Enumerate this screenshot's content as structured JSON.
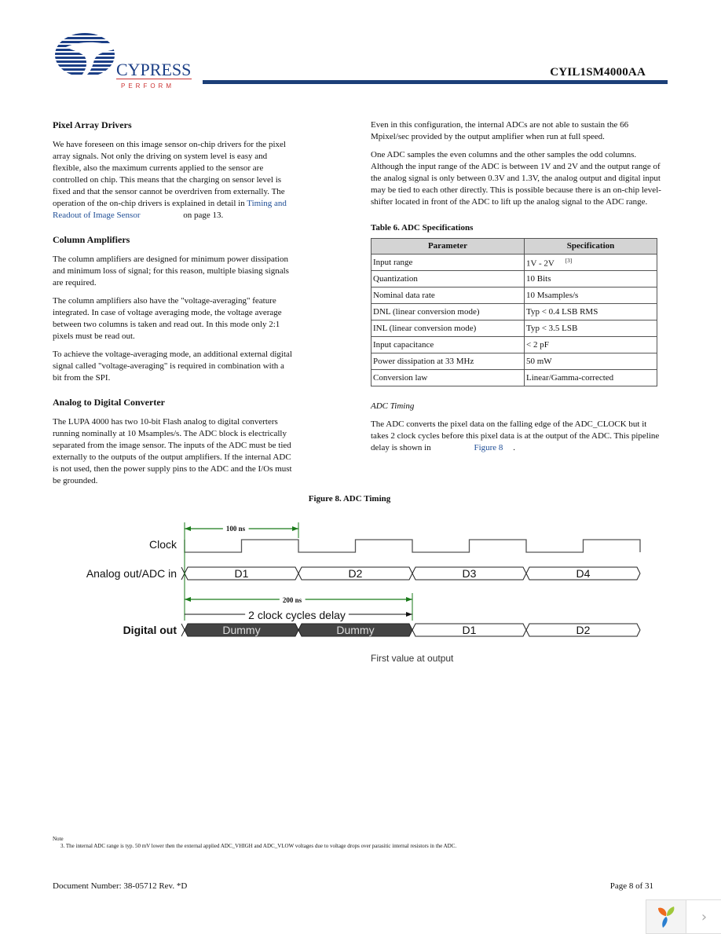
{
  "header": {
    "brand": "CYPRESS",
    "tagline": "PERFORM",
    "doc_id": "CYIL1SM4000AA"
  },
  "left_column": {
    "sections": [
      {
        "heading": "Pixel Array Drivers",
        "paragraphs": [
          "We have foreseen on this image sensor on-chip drivers for the pixel array signals. Not only the driving on system level is easy and flexible, also the maximum currents applied to the sensor are controlled on chip. This means that the charging on sensor level is fixed and that the sensor cannot be overdriven from externally. The operation of the on-chip drivers is explained in detail in"
        ],
        "link_text": "Timing and Readout of Image Sensor",
        "link_suffix": "on page 13."
      },
      {
        "heading": "Column Amplifiers",
        "paragraphs": [
          "The column amplifiers are designed for minimum power dissipation and minimum loss of signal; for this reason, multiple biasing signals are required.",
          "The column amplifiers also have the \"voltage-averaging\" feature integrated. In case of voltage averaging mode, the voltage average between two columns is taken and read out. In this mode only 2:1 pixels must be read out.",
          "To achieve the voltage-averaging mode, an additional external digital signal called \"voltage-averaging\" is required in combination with a bit from the SPI."
        ]
      },
      {
        "heading": "Analog to Digital Converter",
        "paragraphs": [
          "The LUPA 4000 has two 10-bit Flash analog to digital converters running nominally at 10 Msamples/s. The ADC block is electrically separated from the image sensor. The inputs of the ADC must be tied externally to the outputs of the output amplifiers. If the internal ADC is not used, then the power supply pins to the ADC and the I/Os must be grounded."
        ]
      }
    ]
  },
  "right_column": {
    "paragraphs": [
      "Even in this configuration, the internal ADCs are not able to sustain the 66 Mpixel/sec provided by the output amplifier when run at full speed.",
      "One ADC samples the even columns and the other samples the odd columns. Although the input range of the ADC is between 1V and 2V and the output range of the analog signal is only between 0.3V and 1.3V, the analog output and digital input may be tied to each other directly. This is possible because there is an on-chip level-shifter located in front of the ADC to lift up the analog signal to the ADC range."
    ],
    "table": {
      "title": "Table 6. ADC Specifications",
      "headers": [
        "Parameter",
        "Specification"
      ],
      "rows": [
        [
          "Input range",
          "1V - 2V",
          "[3]"
        ],
        [
          "Quantization",
          "10 Bits"
        ],
        [
          "Nominal data rate",
          "10 Msamples/s"
        ],
        [
          "DNL (linear conversion mode)",
          "Typ < 0.4 LSB RMS"
        ],
        [
          "INL (linear conversion mode)",
          "Typ < 3.5 LSB"
        ],
        [
          "Input capacitance",
          "< 2 pF"
        ],
        [
          "Power dissipation at 33 MHz",
          "50 mW"
        ],
        [
          "Conversion law",
          "Linear/Gamma-corrected"
        ]
      ]
    },
    "subheading": "ADC Timing",
    "timing_paragraph": "The ADC converts the pixel data on the falling edge of the ADC_CLOCK but it takes 2 clock cycles before this pixel data is at the output of the ADC. This pipeline delay is shown in",
    "timing_link": "Figure 8",
    "timing_suffix": "."
  },
  "figure": {
    "title": "Figure 8.  ADC Timing",
    "labels": {
      "clock": "Clock",
      "analog": "Analog out/ADC in",
      "digital": "Digital out",
      "period": "100 ns",
      "delay_time": "200 ns",
      "delay_label": "2 clock cycles delay",
      "first_value": "First value at output"
    },
    "analog_cells": [
      "D1",
      "D2",
      "D3",
      "D4"
    ],
    "digital_cells": [
      {
        "label": "Dummy",
        "dummy": true
      },
      {
        "label": "Dummy",
        "dummy": true
      },
      {
        "label": "D1",
        "dummy": false
      },
      {
        "label": "D2",
        "dummy": false
      }
    ],
    "colors": {
      "signal": "#555555",
      "dimension": "#1a7a1a",
      "dummy_fill": "#444444"
    }
  },
  "footnote": {
    "label": "Note",
    "text": "3.  The internal ADC range is typ. 50 mV lower then the external applied ADC_VHIGH and ADC_VLOW voltages due to voltage drops over parasitic internal resistors in the ADC."
  },
  "footer": {
    "doc_number": "Document Number: 38-05712  Rev. *D",
    "page": "Page 8 of 31"
  },
  "widget": {
    "next_glyph": "›"
  }
}
